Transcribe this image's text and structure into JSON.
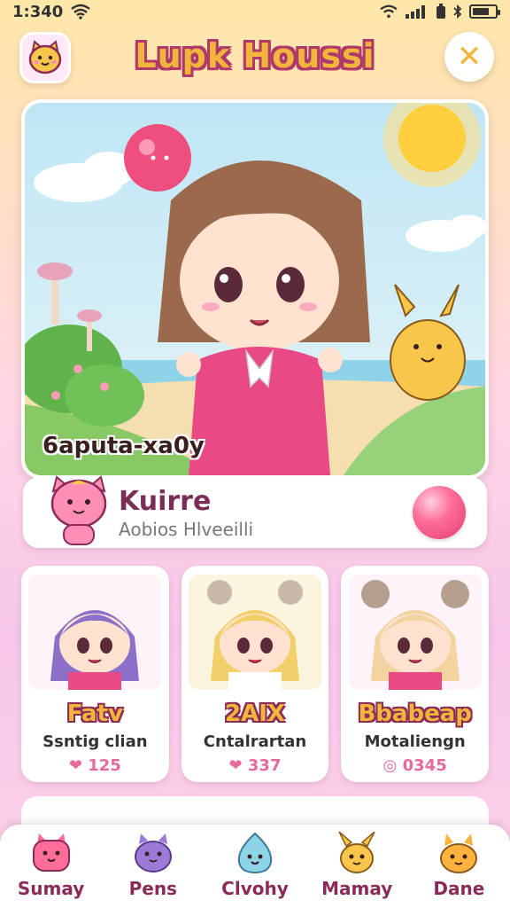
{
  "status": {
    "time": "1:340"
  },
  "header": {
    "title": "Lupk Houssi",
    "close_label": "✕"
  },
  "hero": {
    "caption": "6aputa-xa0y"
  },
  "profile": {
    "name": "Kuirre",
    "subtitle": "Aobios Hlveeilli"
  },
  "cards": [
    {
      "title": "Fatv",
      "subtitle": "Ssntig clian",
      "count": "125",
      "accent": "#9b7ad8"
    },
    {
      "title": "2AIX",
      "subtitle": "Cntalrartan",
      "count": "337",
      "accent": "#f2cf6a"
    },
    {
      "title": "Bbabeap",
      "subtitle": "Motaliengn",
      "count": "0345",
      "accent": "#f3d3a0"
    }
  ],
  "nav": [
    {
      "label": "Sumay",
      "icon": "pink-cat-icon"
    },
    {
      "label": "Pens",
      "icon": "purple-cat-icon"
    },
    {
      "label": "Clvohy",
      "icon": "blue-blob-icon"
    },
    {
      "label": "Mamay",
      "icon": "bunny-icon"
    },
    {
      "label": "Dane",
      "icon": "orange-cat-icon"
    }
  ],
  "colors": {
    "accent": "#f0b53a",
    "brand": "#b0396b",
    "pink": "#ff6d98"
  }
}
